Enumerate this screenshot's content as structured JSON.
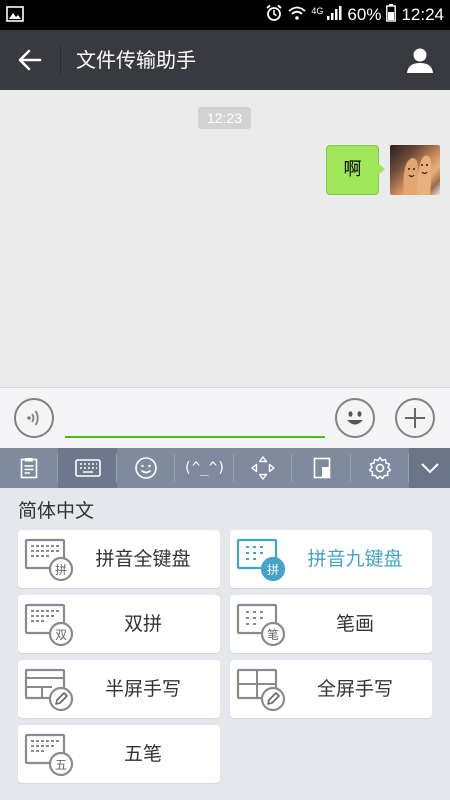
{
  "status_bar": {
    "network": "4G",
    "battery": "60%",
    "time": "12:24"
  },
  "header": {
    "title": "文件传输助手"
  },
  "chat": {
    "timestamp": "12:23",
    "messages": [
      {
        "text": "啊",
        "from": "me"
      }
    ]
  },
  "input": {
    "value": "",
    "placeholder": ""
  },
  "keyboard_toolbar": {
    "kaomoji": "(^_^)",
    "items": [
      "clipboard-icon",
      "keyboard-icon",
      "smiley-icon",
      "kaomoji",
      "cursor-move-icon",
      "one-hand-icon",
      "settings-icon",
      "collapse-icon"
    ]
  },
  "keyboard_panel": {
    "heading": "简体中文",
    "options": [
      {
        "label": "拼音全键盘",
        "badge": "拼",
        "selected": false
      },
      {
        "label": "拼音九键盘",
        "badge": "拼",
        "selected": true
      },
      {
        "label": "双拼",
        "badge": "双",
        "selected": false
      },
      {
        "label": "笔画",
        "badge": "笔",
        "selected": false
      },
      {
        "label": "半屏手写",
        "badge": "",
        "selected": false
      },
      {
        "label": "全屏手写",
        "badge": "",
        "selected": false
      },
      {
        "label": "五笔",
        "badge": "五",
        "selected": false
      }
    ]
  },
  "colors": {
    "title_bar": "#393a3f",
    "bubble": "#9fe658",
    "input_underline": "#45c01a",
    "selected_option": "#44a3c8",
    "toolbar": "#7f8a9e"
  }
}
